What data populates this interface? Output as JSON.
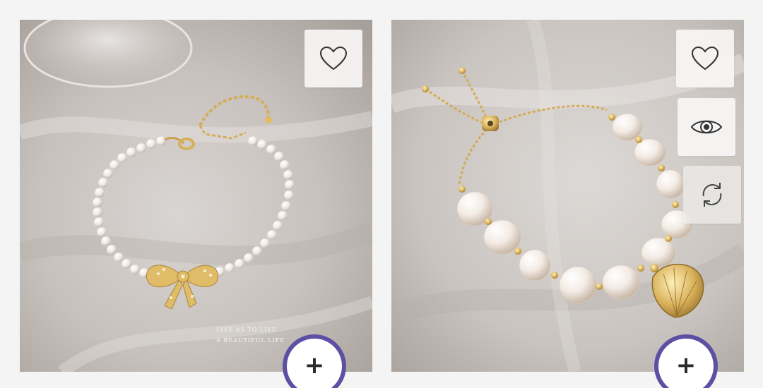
{
  "products": [
    {
      "image_alt": "",
      "watermark_lines": [
        "LIVE AS TO LIVE",
        "A BEAUTIFUL LIFE"
      ],
      "actions": [
        {
          "id": "wishlist",
          "icon": "heart-icon"
        }
      ],
      "add_button": {
        "icon": "plus-icon",
        "label": "+"
      }
    },
    {
      "image_alt": "",
      "actions": [
        {
          "id": "wishlist",
          "icon": "heart-icon"
        },
        {
          "id": "quick-view",
          "icon": "eye-icon"
        },
        {
          "id": "compare",
          "icon": "refresh-icon"
        }
      ],
      "add_button": {
        "icon": "plus-icon",
        "label": "+"
      }
    }
  ],
  "colors": {
    "page_background": "#f4f4f5",
    "add_button_ring": "#5d4fa3",
    "icon_stroke": "#333333"
  }
}
